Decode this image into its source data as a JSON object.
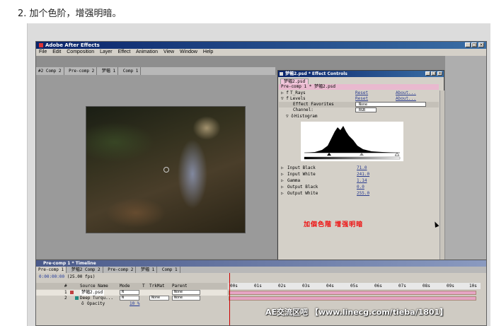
{
  "article": {
    "caption": "2. 加个色阶，增强明暗。"
  },
  "app": {
    "title": "Adobe After Effects",
    "menu": [
      "File",
      "Edit",
      "Composition",
      "Layer",
      "Effect",
      "Animation",
      "View",
      "Window",
      "Help"
    ],
    "window_controls": [
      "_",
      "□",
      "×"
    ]
  },
  "comp_tabs": [
    "#2 Comp 2",
    "Pre-comp 2",
    "梦幅 1",
    "Comp 1"
  ],
  "effect_controls": {
    "title": "梦幅2.psd * Effect Controls",
    "tab": "梦幅2.psd",
    "path": "Pre-comp 1 * 梦幅2.psd",
    "effects": [
      {
        "name": "T_Rays",
        "reset": "Reset",
        "about": "About..."
      },
      {
        "name": "Levels",
        "reset": "Reset",
        "about": "About..."
      }
    ],
    "effect_favorites_label": "Effect Favorites",
    "effect_favorites_value": "None",
    "channel_label": "Channel:",
    "channel_value": "RGB",
    "histogram_label": "Histogram",
    "params": [
      {
        "label": "Input Black",
        "value": "71.0"
      },
      {
        "label": "Input White",
        "value": "241.0"
      },
      {
        "label": "Gamma",
        "value": "1.14"
      },
      {
        "label": "Output Black",
        "value": "0.0"
      },
      {
        "label": "Output White",
        "value": "255.0"
      }
    ],
    "overlay_text": "加個色階 增强明暗"
  },
  "timeline": {
    "title": "Pre-comp 1 * Timeline",
    "tabs": [
      "Pre-comp 1",
      "梦幅2 Comp 2",
      "Pre-comp 2",
      "梦幅 1",
      "Comp 1"
    ],
    "timecode": "0:00:00:00",
    "fps": "(25.00 fps)",
    "headers": [
      "#",
      "Source Name",
      "Mode",
      "T",
      "TrkMat",
      "Parent"
    ],
    "ruler": [
      "00s",
      "01s",
      "02s",
      "03s",
      "04s",
      "05s",
      "06s",
      "07s",
      "08s",
      "09s",
      "10s"
    ],
    "layers": [
      {
        "num": "1",
        "name": "梦幅2.psd",
        "mode": "N",
        "trkmat": "",
        "parent": "None",
        "color": "#c04040"
      },
      {
        "num": "2",
        "name": "Deep Turqu...",
        "mode": "N",
        "trkmat": "None",
        "parent": "None",
        "color": "#208a80"
      }
    ],
    "opacity_label": "Opacity",
    "opacity_value": "10 %"
  },
  "watermark": "AE交流区吧 【www.linecg.com/tieba/1801】"
}
